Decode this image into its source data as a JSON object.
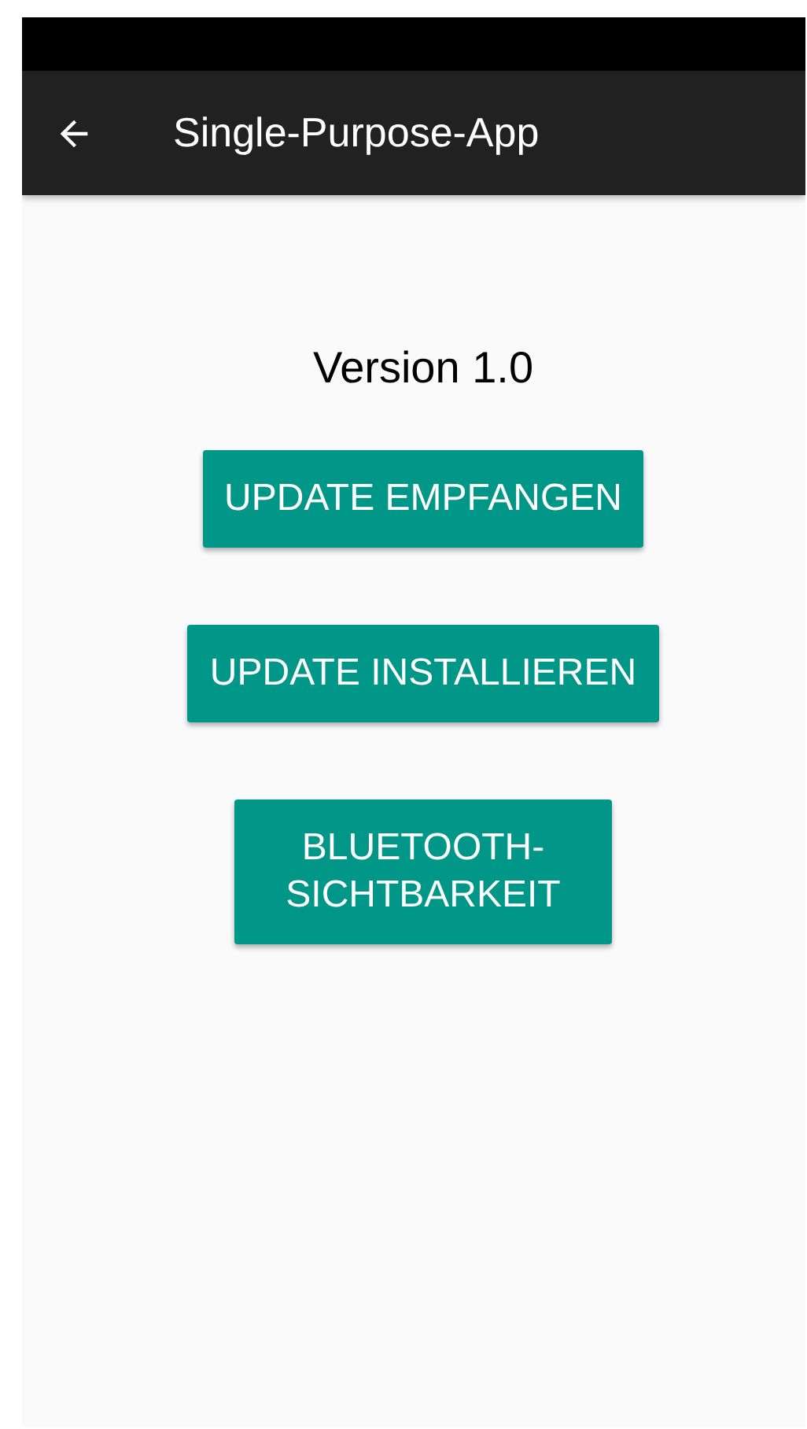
{
  "toolbar": {
    "title": "Single-Purpose-App"
  },
  "version": "Version 1.0",
  "buttons": [
    "UPDATE EMPFANGEN",
    "UPDATE INSTALLIEREN",
    "BLUETOOTH-SICHTBARKEIT"
  ]
}
